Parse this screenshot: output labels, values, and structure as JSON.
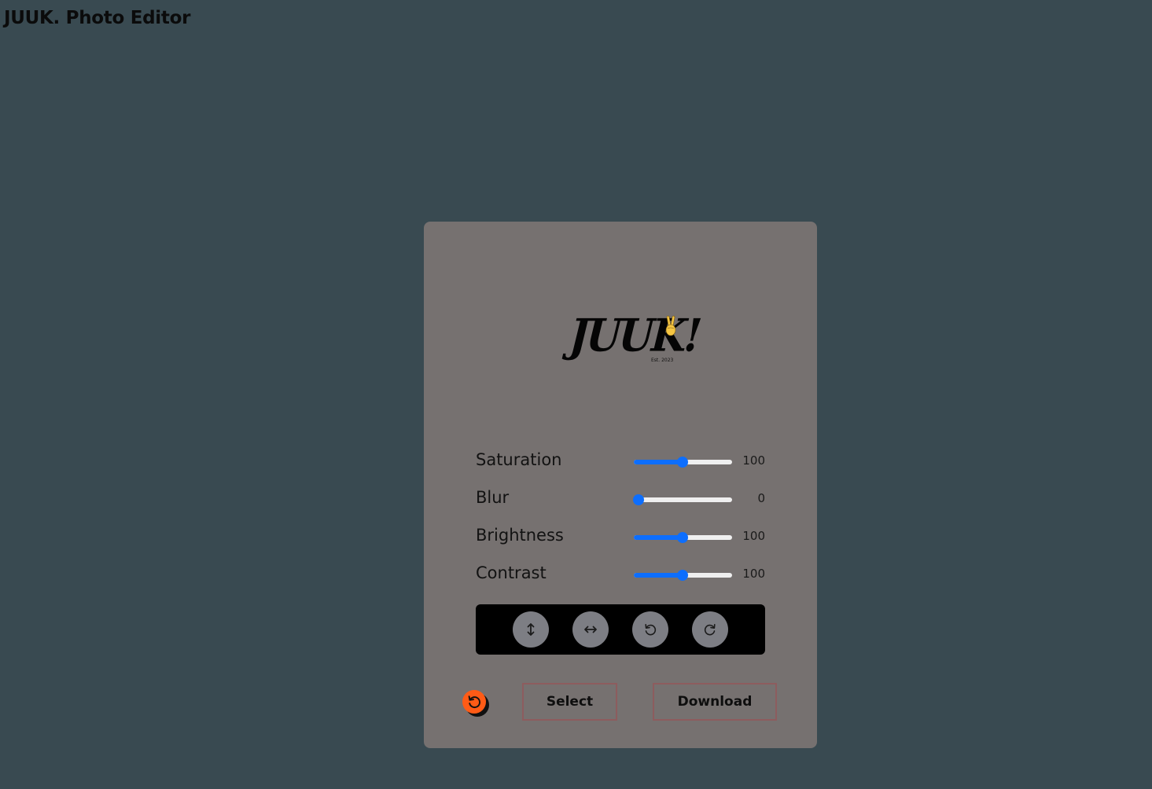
{
  "app": {
    "title": "JUUK. Photo Editor"
  },
  "preview": {
    "logo_text": "JUUK!",
    "logo_tagline": "Est. 2023",
    "logo_icon": "peace-hand-icon"
  },
  "filters": [
    {
      "label": "Saturation",
      "value": "100",
      "level": 0.5
    },
    {
      "label": "Blur",
      "value": "0",
      "level": 0.0
    },
    {
      "label": "Brightness",
      "value": "100",
      "level": 0.5
    },
    {
      "label": "Contrast",
      "value": "100",
      "level": 0.5
    }
  ],
  "transforms": [
    {
      "icon": "flip-vertical-icon"
    },
    {
      "icon": "flip-horizontal-icon"
    },
    {
      "icon": "rotate-left-icon"
    },
    {
      "icon": "rotate-right-icon"
    }
  ],
  "actions": {
    "reset_icon": "reset-icon",
    "select_label": "Select",
    "download_label": "Download"
  },
  "colors": {
    "page_background": "#394a51",
    "card_background": "#767170",
    "slider_accent": "#0d6efd",
    "slider_track": "#efefef",
    "transform_bar": "#000000",
    "transform_button": "#7d7e84",
    "reset_button": "#ff5b16",
    "button_border": "#8d5c5e"
  }
}
